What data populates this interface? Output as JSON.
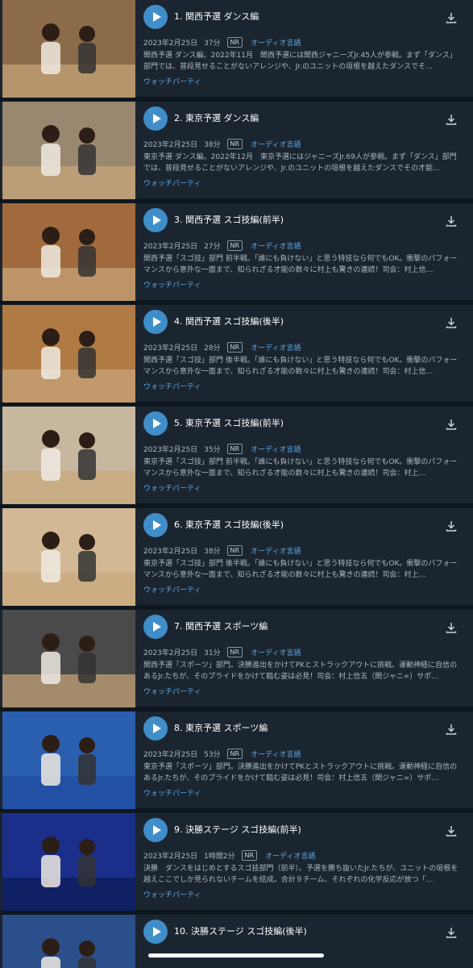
{
  "episodes": [
    {
      "title": "1. 関西予選 ダンス編",
      "date": "2023年2月25日",
      "duration": "37分",
      "rating": "NR",
      "audio": "オーディオ言語",
      "description": "関西予選 ダンス編。2022年11月　関西予選には関西ジャニーズJr.45人が参戦。まず「ダンス」部門では、普段見せることがないアレンジや、Jr.のユニットの垣根を越えたダンスでそ…",
      "watch_party": "ウォッチパーティ",
      "thumb_color": "#8b6b4a"
    },
    {
      "title": "2. 東京予選 ダンス編",
      "date": "2023年2月25日",
      "duration": "38分",
      "rating": "NR",
      "audio": "オーディオ言語",
      "description": "東京予選 ダンス編。2022年12月　東京予選にはジャニーズJr.69人が参戦。まず「ダンス」部門では、普段見せることがないアレンジや、Jr.のユニットの垣根を越えたダンスでその才能…",
      "watch_party": "ウォッチパーティ",
      "thumb_color": "#9a8770"
    },
    {
      "title": "3. 関西予選 スゴ技編(前半)",
      "date": "2023年2月25日",
      "duration": "27分",
      "rating": "NR",
      "audio": "オーディオ言語",
      "description": "関西予選「スゴ技」部門 前半戦。「誰にも負けない」と思う特技なら何でもOK。衝撃のパフォーマンスから意外な一面まで、知られざる才能の数々に村上も驚きの連続！司会：村上信…",
      "watch_party": "ウォッチパーティ",
      "thumb_color": "#a06a3c"
    },
    {
      "title": "4. 関西予選 スゴ技編(後半)",
      "date": "2023年2月25日",
      "duration": "28分",
      "rating": "NR",
      "audio": "オーディオ言語",
      "description": "関西予選「スゴ技」部門 後半戦。「誰にも負けない」と思う特技なら何でもOK。衝撃のパフォーマンスから意外な一面まで、知られざる才能の数々に村上も驚きの連続！司会：村上信…",
      "watch_party": "ウォッチパーティ",
      "thumb_color": "#b07a44"
    },
    {
      "title": "5. 東京予選 スゴ技編(前半)",
      "date": "2023年2月25日",
      "duration": "35分",
      "rating": "NR",
      "audio": "オーディオ言語",
      "description": "東京予選「スゴ技」部門 前半戦。「誰にも負けない」と思う特技なら何でもOK。衝撃のパフォーマンスから意外な一面まで、知られざる才能の数々に村上も驚きの連続！司会：村上…",
      "watch_party": "ウォッチパーティ",
      "thumb_color": "#c7b79e"
    },
    {
      "title": "6. 東京予選 スゴ技編(後半)",
      "date": "2023年2月25日",
      "duration": "38分",
      "rating": "NR",
      "audio": "オーディオ言語",
      "description": "東京予選「スゴ技」部門 後半戦。「誰にも負けない」と思う特技なら何でもOK。衝撃のパフォーマンスから意外な一面まで、知られざる才能の数々に村上も驚きの連続！司会：村上…",
      "watch_party": "ウォッチパーティ",
      "thumb_color": "#d2b894"
    },
    {
      "title": "7. 関西予選 スポーツ編",
      "date": "2023年2月25日",
      "duration": "31分",
      "rating": "NR",
      "audio": "オーディオ言語",
      "description": "関西予選「スポーツ」部門。決勝進出をかけてPKとストラックアウトに挑戦。運動神経に自信のあるJr.たちが、そのプライドをかけて臨む姿は必見！司会：村上信五（関ジャニ∞）サポ…",
      "watch_party": "ウォッチパーティ",
      "thumb_color": "#4a4a4a"
    },
    {
      "title": "8. 東京予選 スポーツ編",
      "date": "2023年2月25日",
      "duration": "53分",
      "rating": "NR",
      "audio": "オーディオ言語",
      "description": "東京予選「スポーツ」部門。決勝進出をかけてPKとストラックアウトに挑戦。運動神経に自信のあるJr.たちが、そのプライドをかけて臨む姿は必見！司会：村上信五（関ジャニ∞）サポ…",
      "watch_party": "ウォッチパーティ",
      "thumb_color": "#2a5fb0"
    },
    {
      "title": "9. 決勝ステージ スゴ技編(前半)",
      "date": "2023年2月25日",
      "duration": "1時間2分",
      "rating": "NR",
      "audio": "オーディオ言語",
      "description": "決勝　ダンスをはじめとするスゴ技部門（前半）。予選を勝ち抜いたJr.たちが、ユニットの垣根を越えここでしか見られないチームを結成。合計９チーム、それぞれの化学反応が放つ「…",
      "watch_party": "ウォッチパーティ",
      "thumb_color": "#1b2f8a"
    },
    {
      "title": "10. 決勝ステージ スゴ技編(後半)",
      "date": "",
      "duration": "",
      "rating": "",
      "audio": "",
      "description": "",
      "watch_party": "",
      "thumb_color": "#2a4f8a"
    }
  ]
}
